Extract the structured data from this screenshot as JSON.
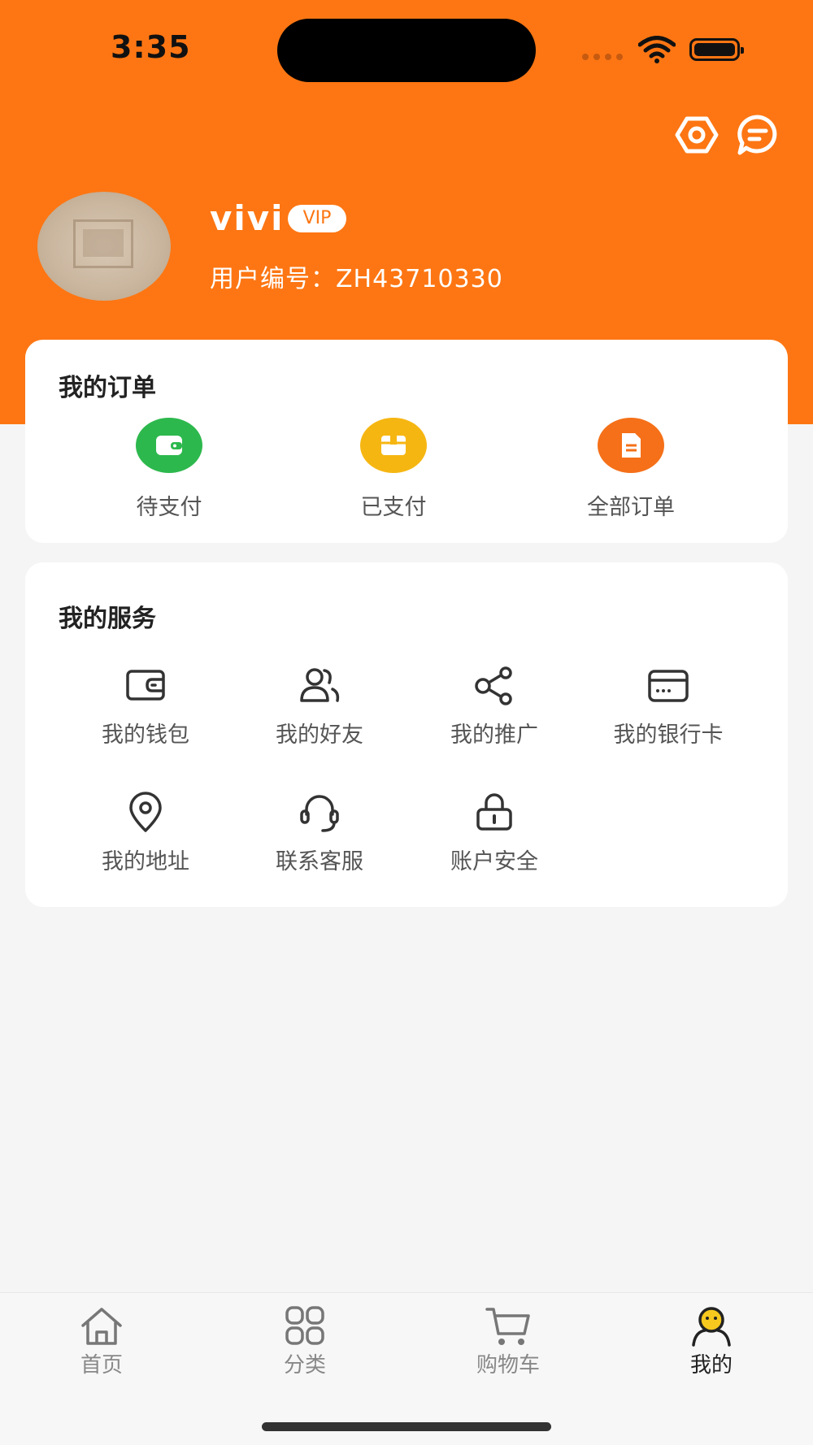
{
  "status_bar": {
    "time": "3:35"
  },
  "header": {
    "username": "vivi",
    "vip_badge": "VIP",
    "user_id_label": "用户编号：ZH43710330",
    "icons": [
      "settings-icon",
      "message-icon"
    ]
  },
  "orders": {
    "title": "我的订单",
    "items": [
      {
        "label": "待支付",
        "icon": "wallet-icon",
        "color": "#2db84d"
      },
      {
        "label": "已支付",
        "icon": "box-icon",
        "color": "#f6b612"
      },
      {
        "label": "全部订单",
        "icon": "document-icon",
        "color": "#f57018"
      }
    ]
  },
  "services": {
    "title": "我的服务",
    "items": [
      {
        "label": "我的钱包",
        "icon": "wallet-icon"
      },
      {
        "label": "我的好友",
        "icon": "friends-icon"
      },
      {
        "label": "我的推广",
        "icon": "share-icon"
      },
      {
        "label": "我的银行卡",
        "icon": "bank-card-icon"
      },
      {
        "label": "我的地址",
        "icon": "location-icon"
      },
      {
        "label": "联系客服",
        "icon": "headset-icon"
      },
      {
        "label": "账户安全",
        "icon": "lock-icon"
      }
    ]
  },
  "tabbar": {
    "items": [
      {
        "label": "首页",
        "icon": "home-icon",
        "active": false
      },
      {
        "label": "分类",
        "icon": "category-icon",
        "active": false
      },
      {
        "label": "购物车",
        "icon": "cart-icon",
        "active": false
      },
      {
        "label": "我的",
        "icon": "profile-icon",
        "active": true
      }
    ]
  },
  "colors": {
    "brand": "#fd7613",
    "background": "#f5f5f5"
  }
}
